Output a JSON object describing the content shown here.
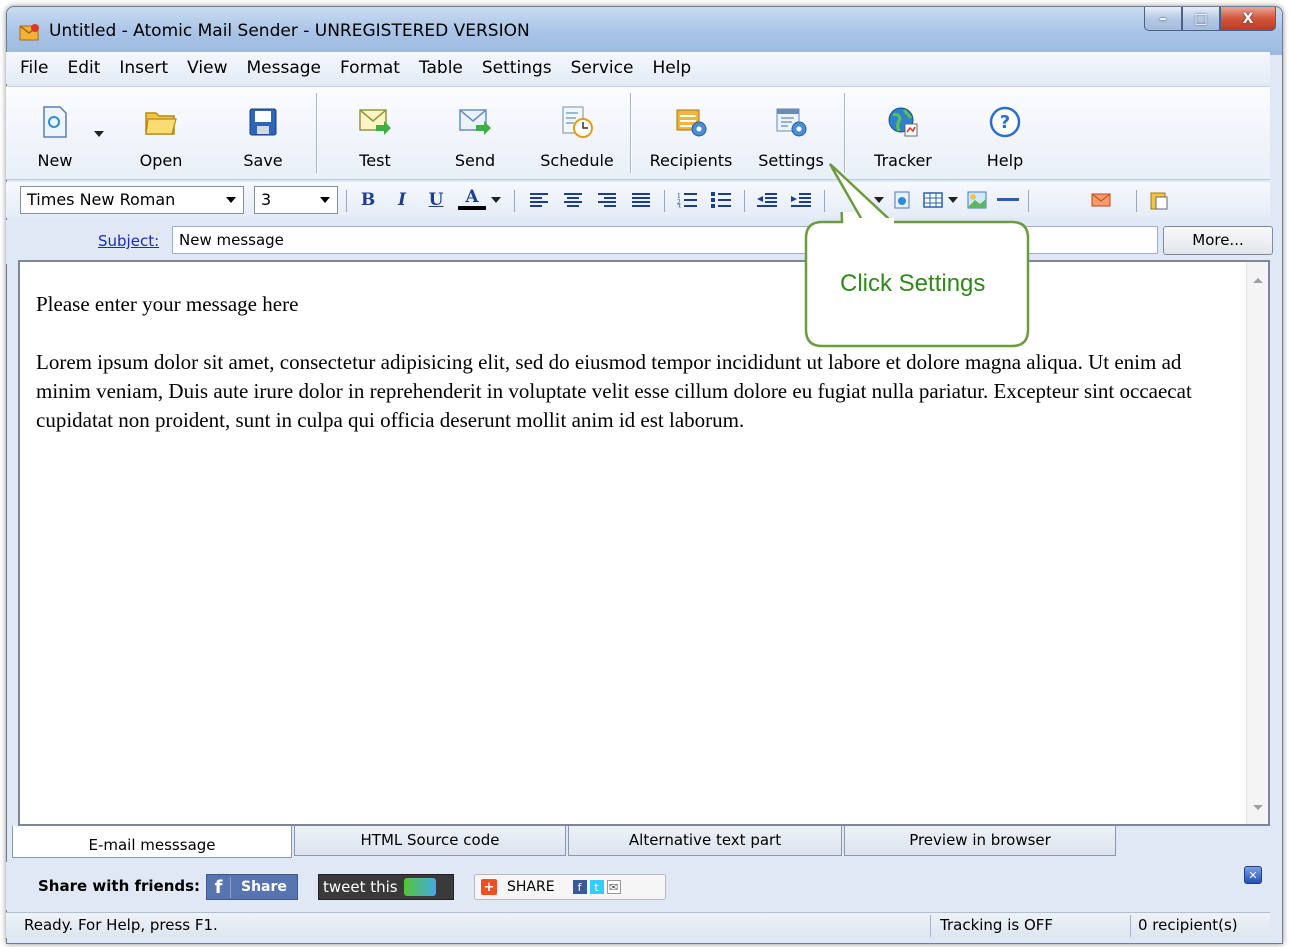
{
  "window": {
    "title": "Untitled - Atomic Mail Sender - UNREGISTERED VERSION",
    "controls": {
      "minimize": "–",
      "maximize": "□",
      "close": "X"
    }
  },
  "menu": [
    "File",
    "Edit",
    "Insert",
    "View",
    "Message",
    "Format",
    "Table",
    "Settings",
    "Service",
    "Help"
  ],
  "toolbar": {
    "new": "New",
    "open": "Open",
    "save": "Save",
    "test": "Test",
    "send": "Send",
    "schedule": "Schedule",
    "recipients": "Recipients",
    "settings": "Settings",
    "tracker": "Tracker",
    "help": "Help"
  },
  "format": {
    "font": "Times New Roman",
    "size": "3",
    "bold": "B",
    "italic": "I",
    "underline": "U",
    "color": "A"
  },
  "subject": {
    "label": "Subject:",
    "value": "New message",
    "more": "More..."
  },
  "editor": {
    "line1": "Please enter your message here",
    "paragraph": "Lorem ipsum dolor sit amet, consectetur adipisicing elit, sed do eiusmod tempor incididunt ut labore et dolore magna aliqua. Ut enim ad minim veniam, Duis aute irure dolor in reprehenderit in voluptate velit esse cillum dolore eu fugiat nulla pariatur. Excepteur sint occaecat cupidatat non proident, sunt in culpa qui officia deserunt mollit anim id est laborum."
  },
  "tabs": [
    "E-mail messsage",
    "HTML Source code",
    "Alternative text part",
    "Preview in browser"
  ],
  "share": {
    "label": "Share with friends:",
    "facebook": "Share",
    "tweet": "tweet this",
    "addthis": "SHARE"
  },
  "status": {
    "ready": "Ready. For Help, press F1.",
    "tracking": "Tracking is OFF",
    "recipients": "0 recipient(s)"
  },
  "callout": {
    "text": "Click Settings"
  },
  "colors": {
    "callout_green": "#2f8a1a",
    "link_blue": "#1a27c9",
    "title_bar": "#a8c3e6"
  }
}
